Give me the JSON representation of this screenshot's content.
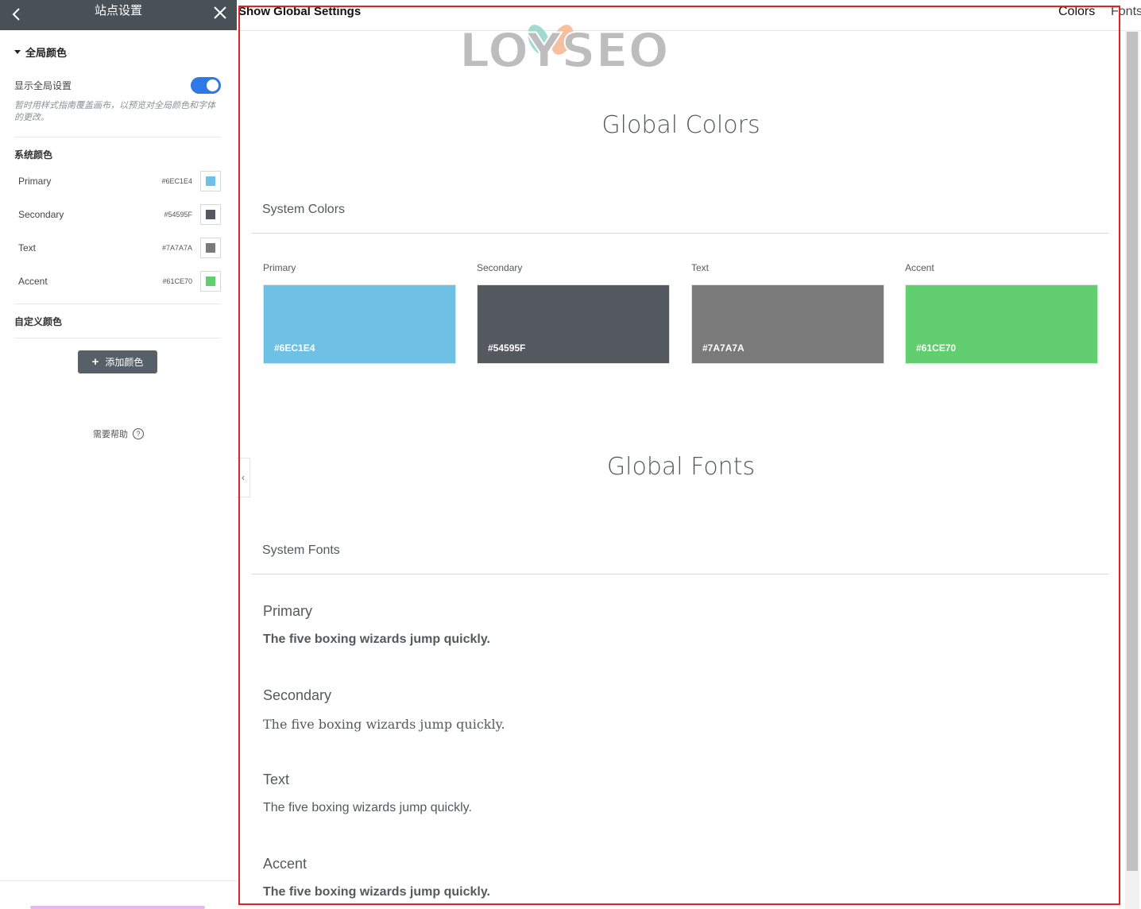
{
  "panel": {
    "title": "站点设置",
    "section_title": "全局颜色",
    "toggle_label": "显示全局设置",
    "toggle_on": true,
    "hint": "暂时用样式指南覆盖画布，以预览对全局颜色和字体的更改。",
    "system_colors_label": "系统颜色",
    "colors": [
      {
        "name": "Primary",
        "hex": "#6EC1E4"
      },
      {
        "name": "Secondary",
        "hex": "#54595F"
      },
      {
        "name": "Text",
        "hex": "#7A7A7A"
      },
      {
        "name": "Accent",
        "hex": "#61CE70"
      }
    ],
    "custom_colors_label": "自定义颜色",
    "add_button": "添加颜色",
    "help_label": "需要帮助",
    "help_icon_glyph": "?"
  },
  "preview": {
    "topbar_title": "Show Global Settings",
    "nav": [
      "Colors",
      "Fonts"
    ],
    "logo_text": "LOYSEO",
    "global_colors_heading": "Global Colors",
    "system_colors_heading": "System Colors",
    "color_cards": [
      {
        "label": "Primary",
        "hex": "#6EC1E4"
      },
      {
        "label": "Secondary",
        "hex": "#54595F"
      },
      {
        "label": "Text",
        "hex": "#7A7A7A"
      },
      {
        "label": "Accent",
        "hex": "#61CE70"
      }
    ],
    "global_fonts_heading": "Global Fonts",
    "system_fonts_heading": "System Fonts",
    "fonts": [
      {
        "label": "Primary",
        "sample": "The five boxing wizards jump quickly."
      },
      {
        "label": "Secondary",
        "sample": "The five boxing wizards jump quickly."
      },
      {
        "label": "Text",
        "sample": "The five boxing wizards jump quickly."
      },
      {
        "label": "Accent",
        "sample": "The five boxing wizards jump quickly."
      }
    ]
  },
  "colors_ui": {
    "header_bg": "#495157",
    "toggle_on": "#2e79e6",
    "highlight_frame": "#e02424"
  }
}
